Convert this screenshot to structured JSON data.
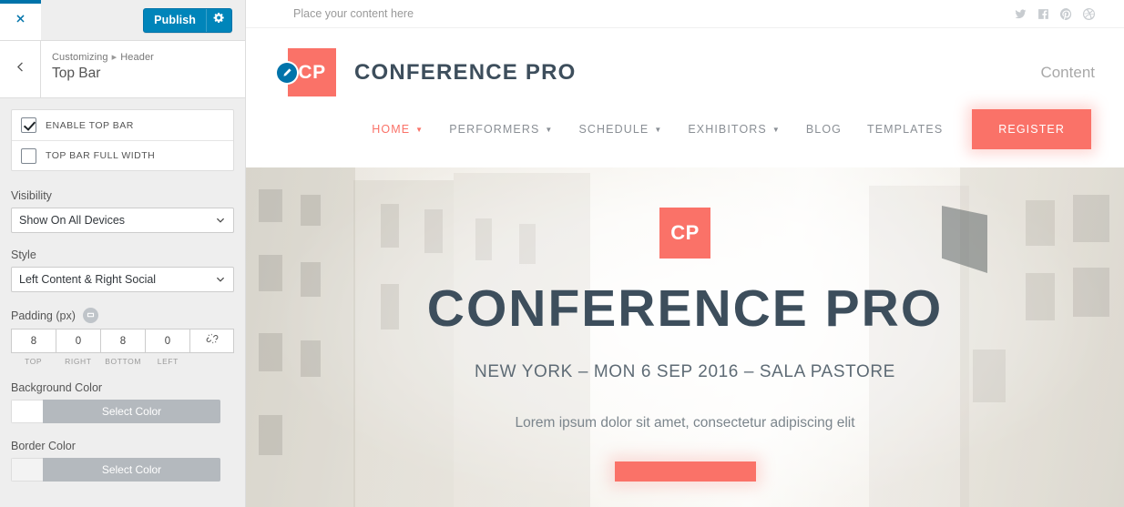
{
  "customizer": {
    "close_label": "Close",
    "publish": {
      "label": "Publish",
      "gear_name": "gear-icon"
    },
    "breadcrumb": {
      "root": "Customizing",
      "separator": "▸",
      "section": "Header"
    },
    "panel_title": "Top Bar",
    "checkboxes": [
      {
        "label": "ENABLE TOP BAR",
        "checked": true
      },
      {
        "label": "TOP BAR FULL WIDTH",
        "checked": false
      }
    ],
    "visibility": {
      "label": "Visibility",
      "value": "Show On All Devices"
    },
    "style": {
      "label": "Style",
      "value": "Left Content & Right Social"
    },
    "padding": {
      "label": "Padding (px)",
      "values": [
        "8",
        "0",
        "8",
        "0"
      ],
      "sides": [
        "TOP",
        "RIGHT",
        "BOTTOM",
        "LEFT"
      ],
      "link_state": "unlinked"
    },
    "background_color": {
      "label": "Background Color",
      "button": "Select Color",
      "swatch": "#ffffff"
    },
    "border_color": {
      "label": "Border Color",
      "button": "Select Color",
      "swatch": "#f3f3f3"
    }
  },
  "preview": {
    "topbar": {
      "text": "Place your content here",
      "social": [
        "twitter",
        "facebook",
        "pinterest",
        "dribbble"
      ]
    },
    "header": {
      "logo_text": "CP",
      "brand_name": "CONFERENCE PRO",
      "content_slot": "Content",
      "nav": [
        {
          "label": "HOME",
          "dropdown": true,
          "active": true
        },
        {
          "label": "PERFORMERS",
          "dropdown": true,
          "active": false
        },
        {
          "label": "SCHEDULE",
          "dropdown": true,
          "active": false
        },
        {
          "label": "EXHIBITORS",
          "dropdown": true,
          "active": false
        },
        {
          "label": "BLOG",
          "dropdown": false,
          "active": false
        },
        {
          "label": "TEMPLATES",
          "dropdown": false,
          "active": false
        }
      ],
      "register_label": "REGISTER"
    },
    "hero": {
      "logo_text": "CP",
      "title": "CONFERENCE PRO",
      "subtitle": "NEW YORK – MON 6 SEP 2016 – SALA PASTORE",
      "description": "Lorem ipsum dolor sit amet, consectetur adipiscing elit"
    }
  },
  "colors": {
    "wp_blue": "#0085ba",
    "accent_coral": "#fa7268",
    "heading_slate": "#3d4e5c"
  }
}
